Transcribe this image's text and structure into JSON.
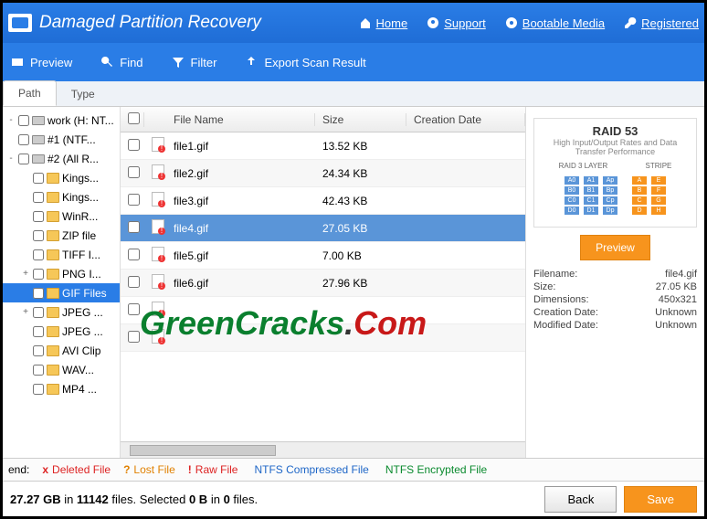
{
  "title": "Damaged Partition Recovery",
  "header_links": [
    {
      "label": "Home",
      "icon": "home"
    },
    {
      "label": "Support",
      "icon": "support"
    },
    {
      "label": "Bootable Media",
      "icon": "disc"
    },
    {
      "label": "Registered",
      "icon": "key"
    }
  ],
  "toolbar": [
    {
      "label": "Preview",
      "icon": "preview"
    },
    {
      "label": "Find",
      "icon": "find"
    },
    {
      "label": "Filter",
      "icon": "filter"
    },
    {
      "label": "Export Scan Result",
      "icon": "export"
    }
  ],
  "tabs": {
    "active": "Path",
    "other": "Type"
  },
  "tree": [
    {
      "label": "work (H: NT...",
      "icon": "disk",
      "level": 0,
      "exp": "-"
    },
    {
      "label": "#1 (NTF...",
      "icon": "disk",
      "level": 0,
      "exp": ""
    },
    {
      "label": "#2 (All R...",
      "icon": "disk",
      "level": 0,
      "exp": "-"
    },
    {
      "label": "Kings...",
      "icon": "folder",
      "level": 1,
      "exp": ""
    },
    {
      "label": "Kings...",
      "icon": "folder",
      "level": 1,
      "exp": ""
    },
    {
      "label": "WinR...",
      "icon": "folder",
      "level": 1,
      "exp": ""
    },
    {
      "label": "ZIP file",
      "icon": "folder",
      "level": 1,
      "exp": ""
    },
    {
      "label": "TIFF I...",
      "icon": "folder",
      "level": 1,
      "exp": ""
    },
    {
      "label": "PNG I...",
      "icon": "folder",
      "level": 1,
      "exp": "+"
    },
    {
      "label": "GIF Files",
      "icon": "folder",
      "level": 1,
      "exp": "",
      "selected": true
    },
    {
      "label": "JPEG ...",
      "icon": "folder",
      "level": 1,
      "exp": "+"
    },
    {
      "label": "JPEG ...",
      "icon": "folder",
      "level": 1,
      "exp": ""
    },
    {
      "label": "AVI Clip",
      "icon": "folder",
      "level": 1,
      "exp": ""
    },
    {
      "label": "WAV...",
      "icon": "folder",
      "level": 1,
      "exp": ""
    },
    {
      "label": "MP4 ...",
      "icon": "folder",
      "level": 1,
      "exp": ""
    }
  ],
  "columns": {
    "name": "File Name",
    "size": "Size",
    "date": "Creation Date"
  },
  "files": [
    {
      "name": "file1.gif",
      "size": "13.52 KB"
    },
    {
      "name": "file2.gif",
      "size": "24.34 KB"
    },
    {
      "name": "file3.gif",
      "size": "42.43 KB"
    },
    {
      "name": "file4.gif",
      "size": "27.05 KB",
      "selected": true
    },
    {
      "name": "file5.gif",
      "size": "7.00 KB"
    },
    {
      "name": "file6.gif",
      "size": "27.96 KB"
    },
    {
      "name": "",
      "size": ""
    },
    {
      "name": "",
      "size": ""
    }
  ],
  "preview": {
    "title": "RAID 53",
    "subtitle": "High Input/Output Rates and Data Transfer Performance",
    "layer1": "RAID 3 LAYER",
    "layer2": "STRIPE",
    "button": "Preview",
    "meta": [
      {
        "k": "Filename:",
        "v": "file4.gif"
      },
      {
        "k": "Size:",
        "v": "27.05 KB"
      },
      {
        "k": "Dimensions:",
        "v": "450x321"
      },
      {
        "k": "Creation Date:",
        "v": "Unknown"
      },
      {
        "k": "Modified Date:",
        "v": "Unknown"
      }
    ]
  },
  "legend": {
    "label": "end:",
    "items": [
      {
        "sym": "x",
        "color": "#d22",
        "text": "Deleted File"
      },
      {
        "sym": "?",
        "color": "#e08000",
        "text": "Lost File"
      },
      {
        "sym": "!",
        "color": "#d22",
        "text": "Raw File"
      },
      {
        "sym": "",
        "color": "#1e66c7",
        "text": "NTFS Compressed File"
      },
      {
        "sym": "",
        "color": "#0a8a2e",
        "text": "NTFS Encrypted File"
      }
    ]
  },
  "status": {
    "size": "27.27 GB",
    "in": "in",
    "files": "11142",
    "files_lbl": "files.",
    "sel": "Selected",
    "b": "0 B",
    "bin": "in",
    "cnt": "0",
    "flbl": "files."
  },
  "buttons": {
    "back": "Back",
    "save": "Save"
  },
  "watermark": {
    "p1": "GreenCracks",
    "p2": ".",
    "p3": "Com"
  }
}
